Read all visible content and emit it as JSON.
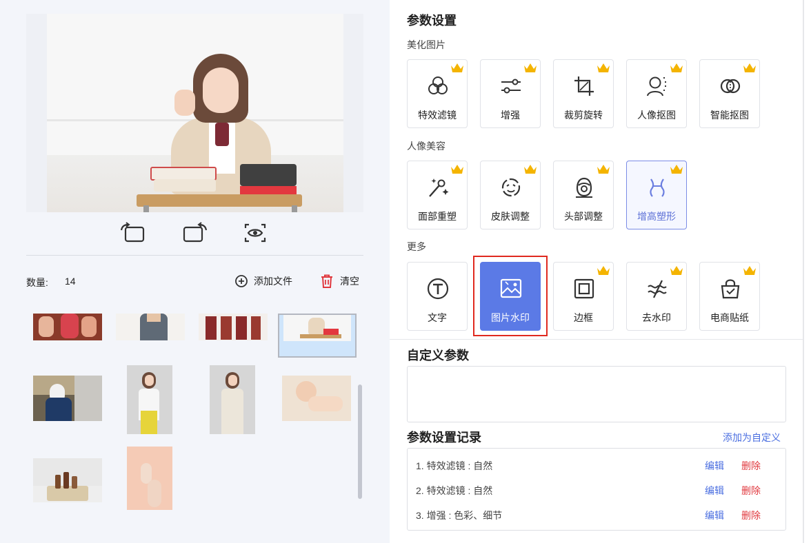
{
  "left": {
    "count_label": "数量:",
    "count_value": "14",
    "add_file_label": "添加文件",
    "clear_label": "清空",
    "rotate_left_icon": "rotate-left-icon",
    "rotate_right_icon": "rotate-right-icon",
    "preview_icon": "eye-scan-icon"
  },
  "right": {
    "title": "参数设置",
    "sections": [
      {
        "label": "美化图片",
        "items": [
          {
            "label": "特效滤镜",
            "icon": "filter-circles-icon",
            "crown": true,
            "state": "normal"
          },
          {
            "label": "增强",
            "icon": "sliders-icon",
            "crown": true,
            "state": "normal"
          },
          {
            "label": "裁剪旋转",
            "icon": "crop-icon",
            "crown": true,
            "state": "normal"
          },
          {
            "label": "人像抠图",
            "icon": "portrait-cutout-icon",
            "crown": true,
            "state": "normal"
          },
          {
            "label": "智能抠图",
            "icon": "smart-cutout-icon",
            "crown": true,
            "state": "normal"
          }
        ]
      },
      {
        "label": "人像美容",
        "items": [
          {
            "label": "面部重塑",
            "icon": "magic-wand-icon",
            "crown": true,
            "state": "normal"
          },
          {
            "label": "皮肤调整",
            "icon": "face-skin-icon",
            "crown": true,
            "state": "normal"
          },
          {
            "label": "头部调整",
            "icon": "head-icon",
            "crown": true,
            "state": "normal"
          },
          {
            "label": "增高塑形",
            "icon": "body-shape-icon",
            "crown": true,
            "state": "highlighted"
          }
        ]
      },
      {
        "label": "更多",
        "items": [
          {
            "label": "文字",
            "icon": "text-circle-icon",
            "crown": false,
            "state": "normal"
          },
          {
            "label": "图片水印",
            "icon": "image-watermark-icon",
            "crown": false,
            "state": "selected"
          },
          {
            "label": "边框",
            "icon": "frame-icon",
            "crown": true,
            "state": "normal"
          },
          {
            "label": "去水印",
            "icon": "remove-watermark-icon",
            "crown": true,
            "state": "normal"
          },
          {
            "label": "电商贴纸",
            "icon": "shopping-bag-icon",
            "crown": true,
            "state": "normal"
          }
        ]
      }
    ],
    "custom_title": "自定义参数",
    "record_title": "参数设置记录",
    "add_custom_label": "添加为自定义",
    "records": [
      {
        "text": "1.  特效滤镜 : 自然",
        "edit": "编辑",
        "delete": "删除"
      },
      {
        "text": "2.  特效滤镜 : 自然",
        "edit": "编辑",
        "delete": "删除"
      },
      {
        "text": "3.  增强 : 色彩、细节",
        "edit": "编辑",
        "delete": "删除"
      }
    ]
  },
  "colors": {
    "accent": "#5b7ae6",
    "link": "#4a6ee0",
    "danger": "#e0383e",
    "crown": "#f4b400",
    "selection_frame": "#e0291f"
  }
}
